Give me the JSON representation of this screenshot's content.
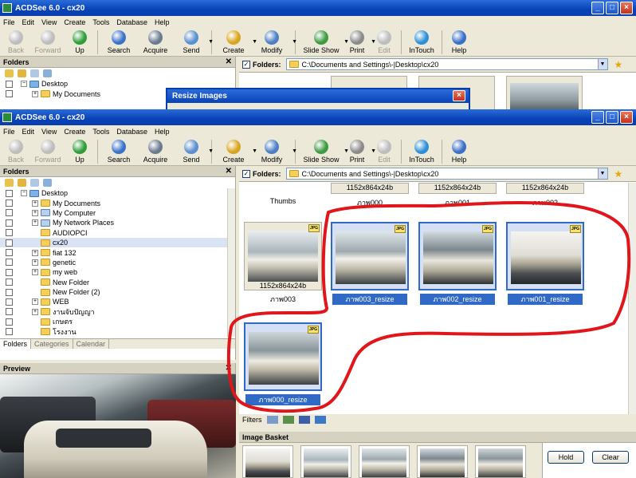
{
  "app": {
    "title": "ACDSee 6.0 - cx20",
    "window_controls": [
      "minimize-icon",
      "maximize-icon",
      "close-icon"
    ]
  },
  "menu": [
    "File",
    "Edit",
    "View",
    "Create",
    "Tools",
    "Database",
    "Help"
  ],
  "toolbar": [
    {
      "label": "Back",
      "icon": "back-arrow-icon",
      "enabled": false,
      "color": "#bdbdbd"
    },
    {
      "label": "Forward",
      "icon": "forward-arrow-icon",
      "enabled": false,
      "color": "#bdbdbd"
    },
    {
      "label": "Up",
      "icon": "up-arrow-icon",
      "enabled": true,
      "color": "#2f9e3a"
    },
    {
      "label": "Search",
      "icon": "search-icon",
      "enabled": true,
      "color": "#3a72c9"
    },
    {
      "label": "Acquire",
      "icon": "camera-icon",
      "enabled": true,
      "color": "#6b7a8f"
    },
    {
      "label": "Send",
      "icon": "send-icon",
      "enabled": true,
      "color": "#5a8fd0"
    },
    {
      "label": "Create",
      "icon": "wand-icon",
      "enabled": true,
      "color": "#d9a520"
    },
    {
      "label": "Modify",
      "icon": "brush-icon",
      "enabled": true,
      "color": "#4d7fc4"
    },
    {
      "label": "Slide Show",
      "icon": "slideshow-icon",
      "enabled": true,
      "color": "#3f9b43"
    },
    {
      "label": "Print",
      "icon": "printer-icon",
      "enabled": true,
      "color": "#8a8a8a"
    },
    {
      "label": "Edit",
      "icon": "edit-icon",
      "enabled": false,
      "color": "#bdbdbd"
    },
    {
      "label": "InTouch",
      "icon": "globe-icon",
      "enabled": true,
      "color": "#2f8fd6"
    },
    {
      "label": "Help",
      "icon": "help-icon",
      "enabled": true,
      "color": "#3a6fc8"
    }
  ],
  "background_window": {
    "dialog_title": "Resize Images",
    "folders_title": "Folders",
    "tree": [
      "Desktop",
      "My Documents"
    ],
    "path_label": "Folders:",
    "path": "C:\\Documents and Settings\\-|Desktop\\cx20"
  },
  "folders_pane": {
    "title": "Folders",
    "tree": [
      {
        "label": "Desktop",
        "level": 0,
        "expander": "−",
        "icon": "blue"
      },
      {
        "label": "My Documents",
        "level": 1,
        "expander": "+",
        "icon": "folder"
      },
      {
        "label": "My Computer",
        "level": 1,
        "expander": "+",
        "icon": "pc"
      },
      {
        "label": "My Network Places",
        "level": 1,
        "expander": "+",
        "icon": "pc"
      },
      {
        "label": "AUDIOPCI",
        "level": 1,
        "expander": "",
        "icon": "folder"
      },
      {
        "label": "cx20",
        "level": 1,
        "expander": "",
        "icon": "folder",
        "selected": true
      },
      {
        "label": "fiat 132",
        "level": 1,
        "expander": "+",
        "icon": "folder"
      },
      {
        "label": "genetic",
        "level": 1,
        "expander": "+",
        "icon": "folder"
      },
      {
        "label": "my web",
        "level": 1,
        "expander": "+",
        "icon": "folder"
      },
      {
        "label": "New Folder",
        "level": 1,
        "expander": "",
        "icon": "folder"
      },
      {
        "label": "New Folder (2)",
        "level": 1,
        "expander": "",
        "icon": "folder"
      },
      {
        "label": "WEB",
        "level": 1,
        "expander": "+",
        "icon": "folder"
      },
      {
        "label": "งานจับปัญญา",
        "level": 1,
        "expander": "+",
        "icon": "folder"
      },
      {
        "label": "เกษตร",
        "level": 1,
        "expander": "",
        "icon": "folder"
      },
      {
        "label": "โรงงาน",
        "level": 1,
        "expander": "",
        "icon": "folder"
      }
    ],
    "tabs": [
      "Folders",
      "Categories",
      "Calendar"
    ]
  },
  "preview": {
    "title": "Preview"
  },
  "path_bar": {
    "label": "Folders:",
    "path": "C:\\Documents and Settings\\-|Desktop\\cx20"
  },
  "thumbnails": {
    "top_row": [
      {
        "name": "Thumbs",
        "dims": ""
      },
      {
        "name": "ภาพ000",
        "dims": "1152x864x24b"
      },
      {
        "name": "ภาพ001",
        "dims": "1152x864x24b"
      },
      {
        "name": "ภาพ002",
        "dims": "1152x864x24b"
      }
    ],
    "items": [
      {
        "name": "ภาพ003",
        "dims": "1152x864x24b",
        "selected": false
      },
      {
        "name": "ภาพ003_resize",
        "dims": "",
        "selected": true
      },
      {
        "name": "ภาพ002_resize",
        "dims": "",
        "selected": true
      },
      {
        "name": "ภาพ001_resize",
        "dims": "",
        "selected": true
      },
      {
        "name": "ภาพ000_resize",
        "dims": "",
        "selected": true
      }
    ],
    "badge": "JPG"
  },
  "bottom_bar": {
    "filters": "Filters"
  },
  "image_basket": {
    "title": "Image Basket",
    "hold_button": "Hold",
    "clear_button": "Clear"
  },
  "colors": {
    "title_bar": "#0a3eae",
    "selection": "#3169c6",
    "annotation_loop": "#e0161a"
  }
}
